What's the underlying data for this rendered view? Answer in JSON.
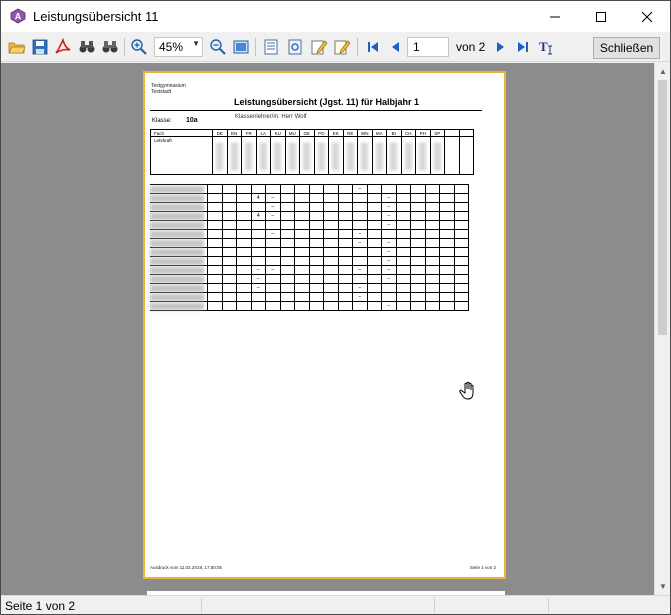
{
  "window": {
    "title": "Leistungsübersicht 11"
  },
  "toolbar": {
    "zoom_value": "45%",
    "page_number": "1",
    "page_of": "von 2",
    "close_label": "Schließen",
    "icons": [
      "open-folder-icon",
      "save-icon",
      "pdf-icon",
      "find-icon",
      "find-next-icon",
      "zoom-in-icon",
      "zoom-out-icon",
      "fit-page-icon",
      "page-setup-icon",
      "properties-icon",
      "edit-icon",
      "edit-page-icon",
      "first-page-icon",
      "previous-page-icon",
      "next-page-icon",
      "last-page-icon",
      "text-tool-icon"
    ]
  },
  "document": {
    "school": "Testgymnasium",
    "city": "Teststadt",
    "title": "Leistungsübersicht (Jgst. 11) für Halbjahr 1",
    "class_label": "Klasse:",
    "class_value": "10a",
    "teacher": "Klassenlehrer/in: Herr Wolf",
    "col_fach": "Fach",
    "col_lehrkraft": "Lehrkraft",
    "subjects": [
      "DE",
      "EN",
      "FR",
      "LA",
      "KU",
      "MU",
      "GE",
      "PO",
      "EK",
      "RE",
      "WN",
      "MA",
      "BI",
      "CH",
      "PH",
      "SP",
      "",
      ""
    ],
    "rows": [
      {
        "c4": "",
        "c10": "–",
        "c11": ""
      },
      {
        "c3": "4",
        "c4": "–",
        "c10": "",
        "c12": "–"
      },
      {
        "c4": "–",
        "c12": "–"
      },
      {
        "c3": "4",
        "c4": "–",
        "c12": "–"
      },
      {
        "c12": "–"
      },
      {
        "c4": "–",
        "c10": "–"
      },
      {
        "c10": "–",
        "c12": "–"
      },
      {
        "c12": "–"
      },
      {
        "c12": "–"
      },
      {
        "c3": "–",
        "c4": "–",
        "c10": "–",
        "c12": "–"
      },
      {
        "c3": "–",
        "c12": "–"
      },
      {
        "c3": "–",
        "c10": "–"
      },
      {
        "c10": "–"
      },
      {
        "c12": "–"
      }
    ],
    "footer_left": "Ausdruck vom 11.02.2019, 17:50:05",
    "footer_right": "Seite 1 von 2"
  },
  "status": {
    "text": "Seite 1 von 2"
  },
  "colors": {
    "page_border": "#e9b437",
    "preview_bg": "#8c8c8c",
    "nav_blue": "#1d5fc9"
  }
}
